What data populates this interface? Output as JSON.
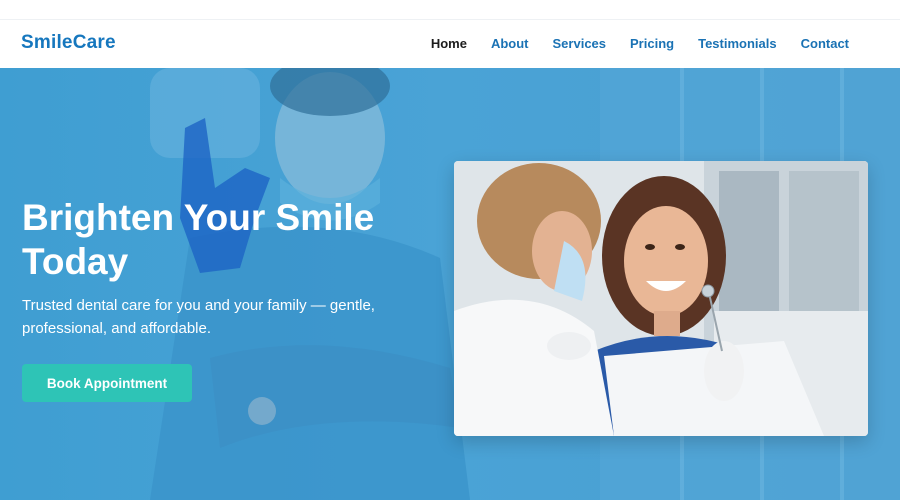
{
  "brand": {
    "name": "SmileCare"
  },
  "nav": {
    "items": [
      {
        "label": "Home",
        "active": true
      },
      {
        "label": "About",
        "active": false
      },
      {
        "label": "Services",
        "active": false
      },
      {
        "label": "Pricing",
        "active": false
      },
      {
        "label": "Testimonials",
        "active": false
      },
      {
        "label": "Contact",
        "active": false
      }
    ]
  },
  "hero": {
    "title_line1": "Brighten Your Smile",
    "title_line2": "Today",
    "subtitle_line1": "Trusted dental care for you and your family — gentle,",
    "subtitle_line2": "professional, and affordable.",
    "cta_label": "Book Appointment",
    "background_image": "dentist-smiling-ok-gesture",
    "photo": "dentist-examining-smiling-patient"
  },
  "colors": {
    "brand": "#1677be",
    "nav_link": "#1a72b4",
    "nav_active": "#1c1c1c",
    "hero_overlay": "#3c9bd0",
    "cta": "#2ec4b6"
  }
}
